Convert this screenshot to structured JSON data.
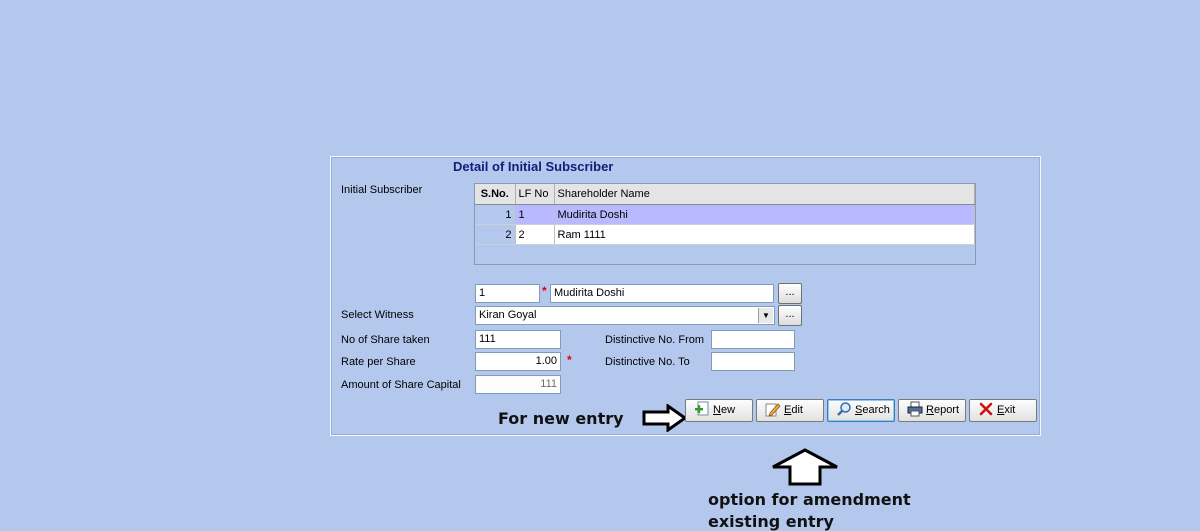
{
  "form": {
    "title": "Detail of Initial Subscriber",
    "initial_subscriber_label": "Initial Subscriber",
    "grid": {
      "columns": [
        "S.No.",
        "LF No",
        "Shareholder Name"
      ],
      "rows": [
        {
          "sno": "1",
          "lf": "1",
          "name": "Mudirita  Doshi"
        },
        {
          "sno": "2",
          "lf": "2",
          "name": "Ram  1111"
        }
      ]
    },
    "lf_value": "1",
    "name_value": "Mudirita  Doshi",
    "witness_label": "Select Witness",
    "witness_value": "Kiran Goyal",
    "shares_label": "No of Share taken",
    "shares_value": "111",
    "rate_label": "Rate per Share",
    "rate_value": "1.00",
    "amount_label": "Amount of Share Capital",
    "amount_value": "111",
    "dist_from_label": "Distinctive No. From",
    "dist_from_value": "",
    "dist_to_label": "Distinctive No. To",
    "dist_to_value": "",
    "dots_label": "...",
    "required_mark": "*"
  },
  "buttons": {
    "new": {
      "access": "N",
      "rest": "ew"
    },
    "edit": {
      "access": "E",
      "rest": "dit"
    },
    "search": {
      "access": "S",
      "rest": "earch"
    },
    "report": {
      "access": "R",
      "rest": "eport"
    },
    "exit": {
      "access": "E",
      "rest": "xit"
    }
  },
  "annotations": {
    "new_entry": "For new entry",
    "amend_line1": "option for amendment",
    "amend_line2": "existing entry"
  },
  "icons": {
    "new": "plus-document-icon",
    "edit": "pencil-icon",
    "search": "magnifier-icon",
    "report": "printer-icon",
    "exit": "red-x-icon",
    "arrow_right": "arrow-right-icon",
    "arrow_up": "arrow-up-icon"
  }
}
